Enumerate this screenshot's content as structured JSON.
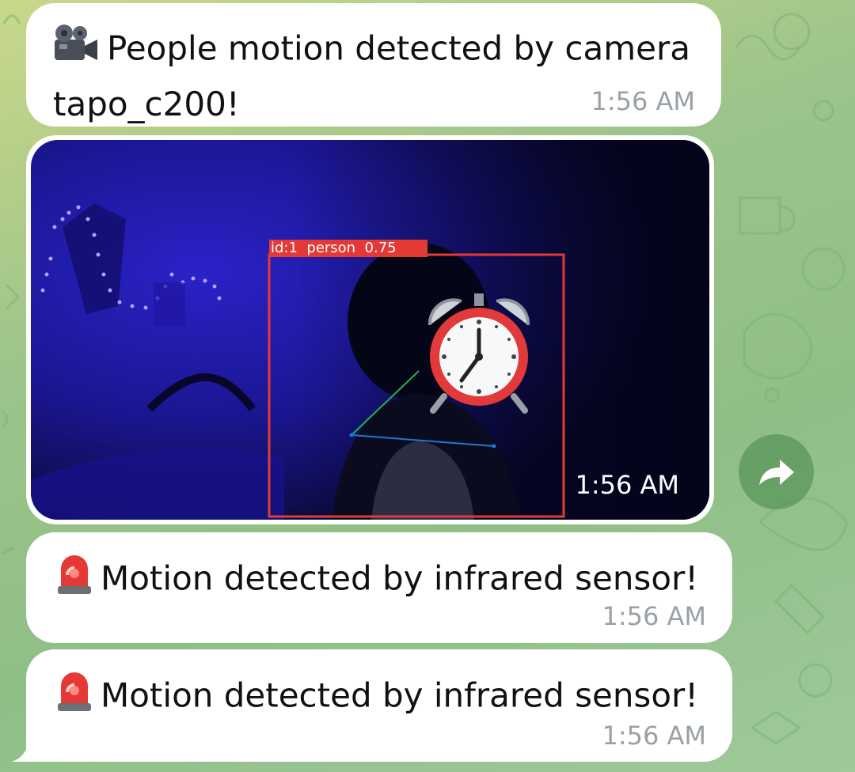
{
  "messages": [
    {
      "icon": "movie-camera-icon",
      "text": "People motion detected by camera tapo_c200!",
      "time": "1:56 AM"
    },
    {
      "type": "photo",
      "detection_label": "id:1  person  0.75",
      "overlay_icon": "alarm-clock-icon",
      "time": "1:56 AM"
    },
    {
      "icon": "police-light-icon",
      "text": "Motion detected by infrared sensor!",
      "time": "1:56 AM"
    },
    {
      "icon": "police-light-icon",
      "text": "Motion detected by infrared sensor!",
      "time": "1:56 AM"
    }
  ],
  "forward_button": {
    "icon": "forward-arrow-icon"
  },
  "colors": {
    "bubble": "#ffffff",
    "timestamp": "#9aa1a6",
    "detection_box": "#e53935",
    "forward_button": "#5a965a"
  }
}
